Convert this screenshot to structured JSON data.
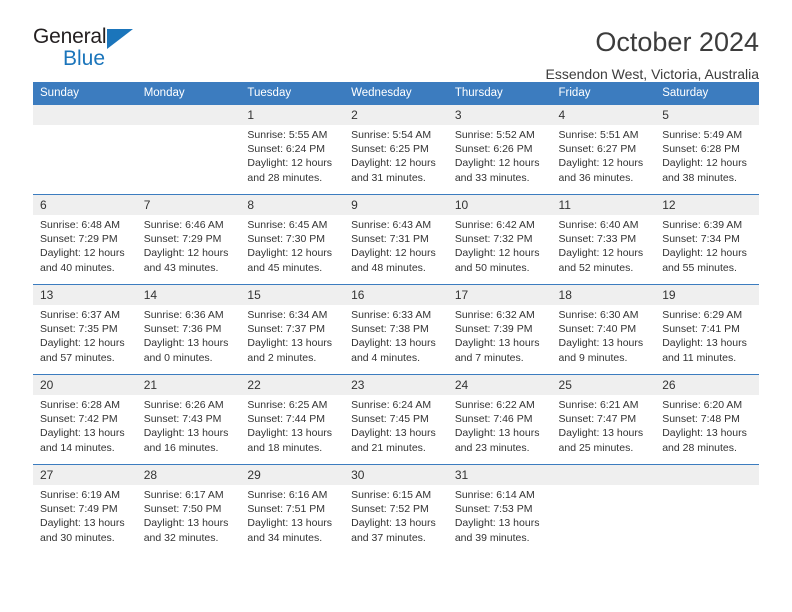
{
  "branding": {
    "logo_primary": "General",
    "logo_secondary": "Blue",
    "triangle_color": "#1b75bb"
  },
  "header": {
    "title": "October 2024",
    "subtitle": "Essendon West, Victoria, Australia"
  },
  "theme": {
    "header_blue": "#3c7cbf",
    "daynum_band": "#efefef",
    "text": "#333333"
  },
  "calendar": {
    "weekday_headers": [
      "Sunday",
      "Monday",
      "Tuesday",
      "Wednesday",
      "Thursday",
      "Friday",
      "Saturday"
    ],
    "weeks": [
      [
        {
          "day": "",
          "blank": true,
          "lines": []
        },
        {
          "day": "",
          "blank": true,
          "lines": []
        },
        {
          "day": "1",
          "lines": [
            "Sunrise: 5:55 AM",
            "Sunset: 6:24 PM",
            "Daylight: 12 hours",
            "and 28 minutes."
          ]
        },
        {
          "day": "2",
          "lines": [
            "Sunrise: 5:54 AM",
            "Sunset: 6:25 PM",
            "Daylight: 12 hours",
            "and 31 minutes."
          ]
        },
        {
          "day": "3",
          "lines": [
            "Sunrise: 5:52 AM",
            "Sunset: 6:26 PM",
            "Daylight: 12 hours",
            "and 33 minutes."
          ]
        },
        {
          "day": "4",
          "lines": [
            "Sunrise: 5:51 AM",
            "Sunset: 6:27 PM",
            "Daylight: 12 hours",
            "and 36 minutes."
          ]
        },
        {
          "day": "5",
          "lines": [
            "Sunrise: 5:49 AM",
            "Sunset: 6:28 PM",
            "Daylight: 12 hours",
            "and 38 minutes."
          ]
        }
      ],
      [
        {
          "day": "6",
          "lines": [
            "Sunrise: 6:48 AM",
            "Sunset: 7:29 PM",
            "Daylight: 12 hours",
            "and 40 minutes."
          ]
        },
        {
          "day": "7",
          "lines": [
            "Sunrise: 6:46 AM",
            "Sunset: 7:29 PM",
            "Daylight: 12 hours",
            "and 43 minutes."
          ]
        },
        {
          "day": "8",
          "lines": [
            "Sunrise: 6:45 AM",
            "Sunset: 7:30 PM",
            "Daylight: 12 hours",
            "and 45 minutes."
          ]
        },
        {
          "day": "9",
          "lines": [
            "Sunrise: 6:43 AM",
            "Sunset: 7:31 PM",
            "Daylight: 12 hours",
            "and 48 minutes."
          ]
        },
        {
          "day": "10",
          "lines": [
            "Sunrise: 6:42 AM",
            "Sunset: 7:32 PM",
            "Daylight: 12 hours",
            "and 50 minutes."
          ]
        },
        {
          "day": "11",
          "lines": [
            "Sunrise: 6:40 AM",
            "Sunset: 7:33 PM",
            "Daylight: 12 hours",
            "and 52 minutes."
          ]
        },
        {
          "day": "12",
          "lines": [
            "Sunrise: 6:39 AM",
            "Sunset: 7:34 PM",
            "Daylight: 12 hours",
            "and 55 minutes."
          ]
        }
      ],
      [
        {
          "day": "13",
          "lines": [
            "Sunrise: 6:37 AM",
            "Sunset: 7:35 PM",
            "Daylight: 12 hours",
            "and 57 minutes."
          ]
        },
        {
          "day": "14",
          "lines": [
            "Sunrise: 6:36 AM",
            "Sunset: 7:36 PM",
            "Daylight: 13 hours",
            "and 0 minutes."
          ]
        },
        {
          "day": "15",
          "lines": [
            "Sunrise: 6:34 AM",
            "Sunset: 7:37 PM",
            "Daylight: 13 hours",
            "and 2 minutes."
          ]
        },
        {
          "day": "16",
          "lines": [
            "Sunrise: 6:33 AM",
            "Sunset: 7:38 PM",
            "Daylight: 13 hours",
            "and 4 minutes."
          ]
        },
        {
          "day": "17",
          "lines": [
            "Sunrise: 6:32 AM",
            "Sunset: 7:39 PM",
            "Daylight: 13 hours",
            "and 7 minutes."
          ]
        },
        {
          "day": "18",
          "lines": [
            "Sunrise: 6:30 AM",
            "Sunset: 7:40 PM",
            "Daylight: 13 hours",
            "and 9 minutes."
          ]
        },
        {
          "day": "19",
          "lines": [
            "Sunrise: 6:29 AM",
            "Sunset: 7:41 PM",
            "Daylight: 13 hours",
            "and 11 minutes."
          ]
        }
      ],
      [
        {
          "day": "20",
          "lines": [
            "Sunrise: 6:28 AM",
            "Sunset: 7:42 PM",
            "Daylight: 13 hours",
            "and 14 minutes."
          ]
        },
        {
          "day": "21",
          "lines": [
            "Sunrise: 6:26 AM",
            "Sunset: 7:43 PM",
            "Daylight: 13 hours",
            "and 16 minutes."
          ]
        },
        {
          "day": "22",
          "lines": [
            "Sunrise: 6:25 AM",
            "Sunset: 7:44 PM",
            "Daylight: 13 hours",
            "and 18 minutes."
          ]
        },
        {
          "day": "23",
          "lines": [
            "Sunrise: 6:24 AM",
            "Sunset: 7:45 PM",
            "Daylight: 13 hours",
            "and 21 minutes."
          ]
        },
        {
          "day": "24",
          "lines": [
            "Sunrise: 6:22 AM",
            "Sunset: 7:46 PM",
            "Daylight: 13 hours",
            "and 23 minutes."
          ]
        },
        {
          "day": "25",
          "lines": [
            "Sunrise: 6:21 AM",
            "Sunset: 7:47 PM",
            "Daylight: 13 hours",
            "and 25 minutes."
          ]
        },
        {
          "day": "26",
          "lines": [
            "Sunrise: 6:20 AM",
            "Sunset: 7:48 PM",
            "Daylight: 13 hours",
            "and 28 minutes."
          ]
        }
      ],
      [
        {
          "day": "27",
          "lines": [
            "Sunrise: 6:19 AM",
            "Sunset: 7:49 PM",
            "Daylight: 13 hours",
            "and 30 minutes."
          ]
        },
        {
          "day": "28",
          "lines": [
            "Sunrise: 6:17 AM",
            "Sunset: 7:50 PM",
            "Daylight: 13 hours",
            "and 32 minutes."
          ]
        },
        {
          "day": "29",
          "lines": [
            "Sunrise: 6:16 AM",
            "Sunset: 7:51 PM",
            "Daylight: 13 hours",
            "and 34 minutes."
          ]
        },
        {
          "day": "30",
          "lines": [
            "Sunrise: 6:15 AM",
            "Sunset: 7:52 PM",
            "Daylight: 13 hours",
            "and 37 minutes."
          ]
        },
        {
          "day": "31",
          "lines": [
            "Sunrise: 6:14 AM",
            "Sunset: 7:53 PM",
            "Daylight: 13 hours",
            "and 39 minutes."
          ]
        },
        {
          "day": "",
          "blank": true,
          "lines": []
        },
        {
          "day": "",
          "blank": true,
          "lines": []
        }
      ]
    ]
  }
}
